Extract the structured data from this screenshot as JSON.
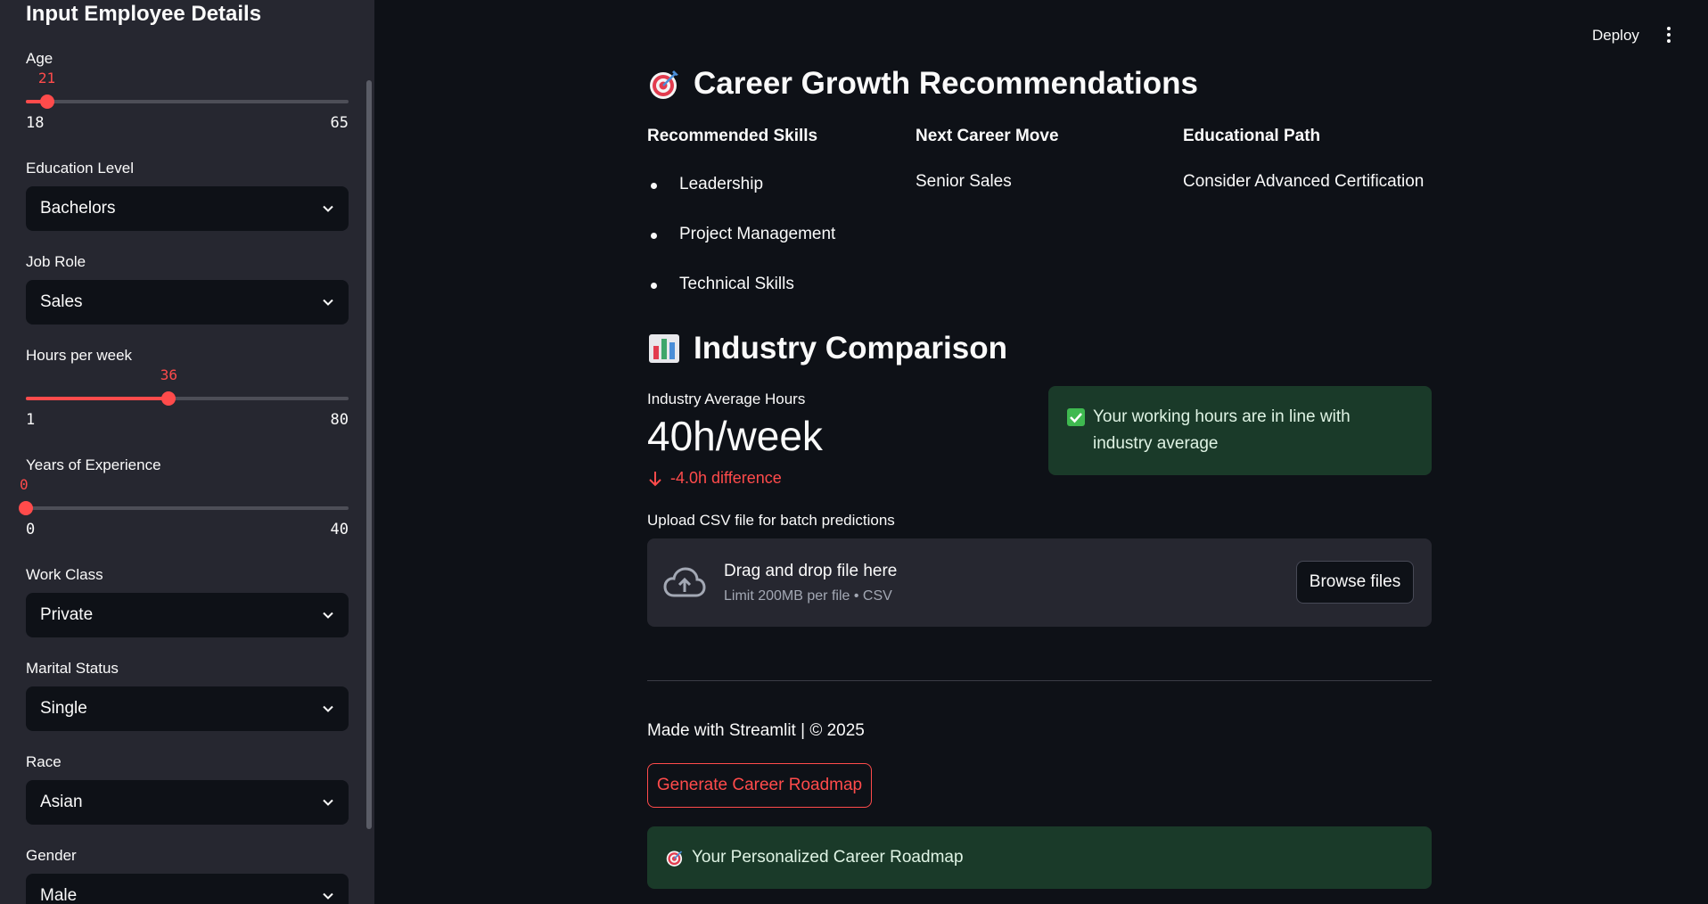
{
  "sidebar": {
    "title": "Input Employee Details",
    "age": {
      "label": "Age",
      "value": "21",
      "min": "18",
      "max": "65",
      "fraction": 0.065
    },
    "education": {
      "label": "Education Level",
      "value": "Bachelors"
    },
    "job_role": {
      "label": "Job Role",
      "value": "Sales"
    },
    "hours": {
      "label": "Hours per week",
      "value": "36",
      "min": "1",
      "max": "80",
      "fraction": 0.443
    },
    "experience": {
      "label": "Years of Experience",
      "value": "0",
      "min": "0",
      "max": "40",
      "fraction": 0.0
    },
    "work_class": {
      "label": "Work Class",
      "value": "Private"
    },
    "marital": {
      "label": "Marital Status",
      "value": "Single"
    },
    "race": {
      "label": "Race",
      "value": "Asian"
    },
    "gender": {
      "label": "Gender",
      "value": "Male"
    }
  },
  "header": {
    "deploy_label": "Deploy"
  },
  "career": {
    "title": "Career Growth Recommendations",
    "icon": "target-icon",
    "skills_header": "Recommended Skills",
    "skills": [
      "Leadership",
      "Project Management",
      "Technical Skills"
    ],
    "next_move_header": "Next Career Move",
    "next_move": "Senior Sales",
    "edu_path_header": "Educational Path",
    "edu_path": "Consider Advanced Certification"
  },
  "industry": {
    "title": "Industry Comparison",
    "icon": "bar-chart-icon",
    "metric_label": "Industry Average Hours",
    "metric_value": "40h/week",
    "metric_delta": "-4.0h difference",
    "alert": "Your working hours are in line with industry average"
  },
  "upload": {
    "label": "Upload CSV file for batch predictions",
    "drop_title": "Drag and drop file here",
    "drop_sub": "Limit 200MB per file • CSV",
    "browse": "Browse files"
  },
  "footer": {
    "made_with": "Made with Streamlit | © 2025",
    "roadmap_button": "Generate Career Roadmap",
    "roadmap_alert": "Your Personalized Career Roadmap"
  },
  "colors": {
    "accent": "#ff4b4b",
    "background": "#0e1117",
    "sidebar": "#262730",
    "success_bg": "#1a3a29"
  }
}
